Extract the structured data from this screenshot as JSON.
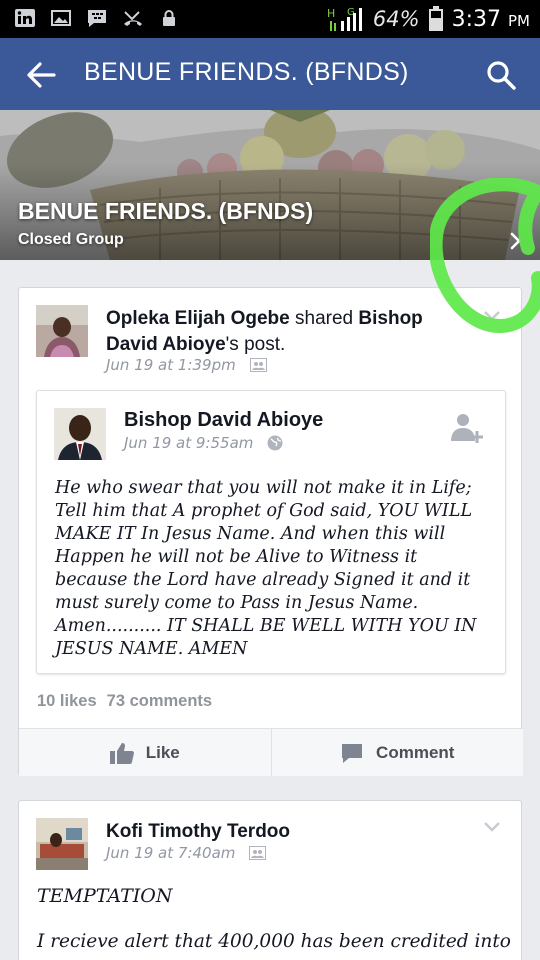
{
  "statusbar": {
    "icons": [
      "linkedin-icon",
      "gallery-icon",
      "bbm-icon",
      "missed-call-icon",
      "lock-icon"
    ],
    "network": "H",
    "network2": "G",
    "battery": "64%",
    "time": "3:37",
    "ampm": "PM"
  },
  "appbar": {
    "title": "BENUE FRIENDS. (BFNDS)"
  },
  "group": {
    "name": "BENUE FRIENDS. (BFNDS)",
    "privacy": "Closed Group"
  },
  "post1": {
    "author": "Opleka Elijah Ogebe",
    "action": " shared ",
    "original_author": "Bishop David Abioye",
    "suffix": "'s post.",
    "time": "Jun 19 at 1:39pm",
    "shared": {
      "author": "Bishop David Abioye",
      "time": "Jun 19 at 9:55am",
      "text": "He who swear that you will not make it in Life; Tell him that A prophet of God said, YOU WILL MAKE IT In Jesus Name. And when this will Happen he will not be Alive to Witness it because the Lord have already Signed it and it must surely come to Pass in Jesus Name. Amen.......... IT SHALL BE WELL WITH YOU IN JESUS NAME. AMEN"
    },
    "likes": "10 likes",
    "comments": "73 comments",
    "like_label": "Like",
    "comment_label": "Comment"
  },
  "post2": {
    "author": "Kofi Timothy Terdoo",
    "time": "Jun 19 at 7:40am",
    "title": "TEMPTATION",
    "text": "I recieve alert that 400,000 has been credited into"
  },
  "colors": {
    "brand": "#3b5998",
    "annotation": "#5ee84a"
  }
}
